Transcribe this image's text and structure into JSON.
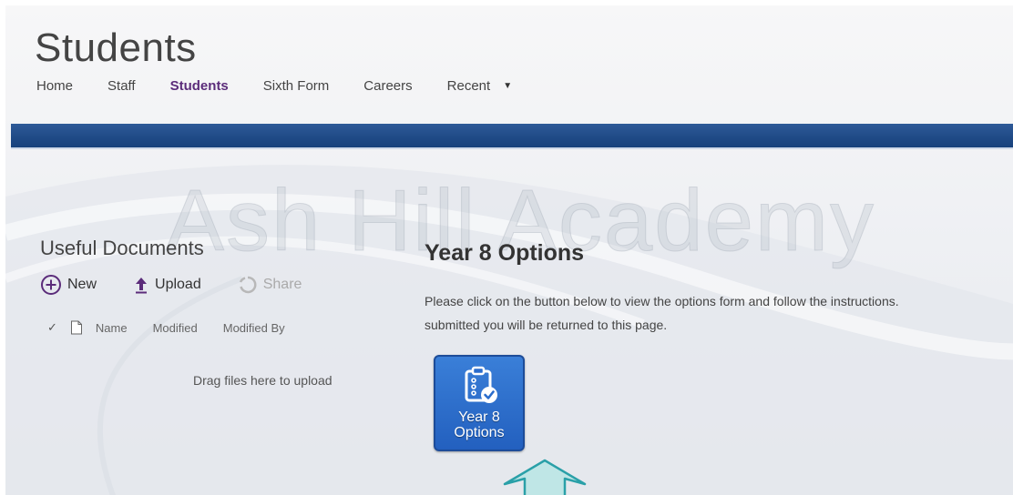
{
  "site": {
    "title": "Students",
    "watermark": "Ash Hill Academy"
  },
  "nav": {
    "items": [
      {
        "label": "Home"
      },
      {
        "label": "Staff"
      },
      {
        "label": "Students",
        "active": true
      },
      {
        "label": "Sixth Form"
      },
      {
        "label": "Careers"
      },
      {
        "label": "Recent"
      }
    ]
  },
  "docs": {
    "title": "Useful Documents",
    "toolbar": {
      "new_label": "New",
      "upload_label": "Upload",
      "share_label": "Share"
    },
    "columns": [
      "Name",
      "Modified",
      "Modified By"
    ],
    "dropzone": "Drag files here to upload"
  },
  "content": {
    "title": "Year 8 Options",
    "line1": "Please click on the button below to view the options form and follow the instructions.",
    "line2": "submitted you will be returned to this page.",
    "tile_line1": "Year 8",
    "tile_line2": "Options"
  },
  "colors": {
    "accent": "#5b2c7a",
    "band": "#1f4a86",
    "tile": "#2a6ccc",
    "arrow": "#bfe6e6"
  },
  "icons": [
    "new-icon",
    "upload-icon",
    "share-icon",
    "checkmark-icon",
    "file-icon",
    "clipboard-check-icon",
    "dropdown-caret-icon",
    "pointer-arrow-icon"
  ]
}
